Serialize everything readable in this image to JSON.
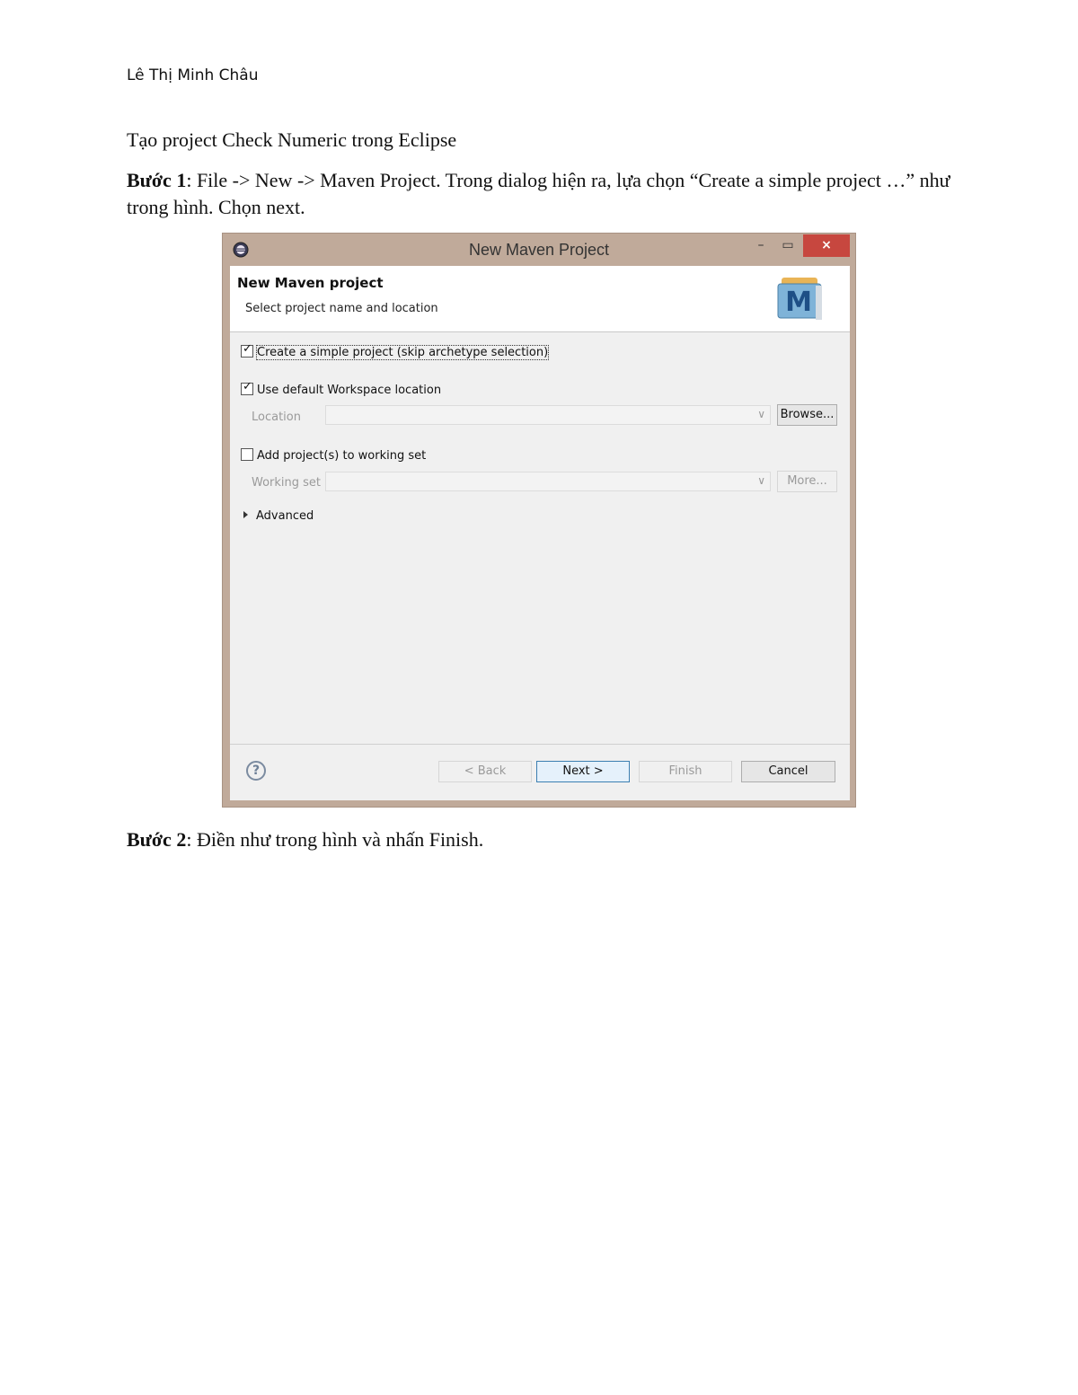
{
  "doc": {
    "author": "Lê Thị Minh Châu",
    "heading": "Tạo project Check Numeric trong Eclipse",
    "step1_label": "Bước 1",
    "step1_text": ": File -> New -> Maven Project. Trong dialog hiện ra, lựa chọn “Create a simple project …” như trong hình. Chọn next.",
    "step2_label": "Bước 2",
    "step2_text": ": Điền như trong hình và nhấn Finish."
  },
  "dialog": {
    "window_title": "New Maven Project",
    "close_glyph": "×",
    "banner_title": "New Maven project",
    "banner_subtitle": "Select project name and location",
    "logo_letter": "M",
    "simple_project_label": "Create a simple project (skip archetype selection)",
    "simple_project_checked": true,
    "default_workspace_label": "Use default Workspace location",
    "default_workspace_checked": true,
    "location_label": "Location",
    "location_value": "",
    "browse_label": "Browse...",
    "working_set_check_label": "Add project(s) to working set",
    "working_set_checked": false,
    "working_set_label": "Working set",
    "working_set_value": "",
    "more_label": "More...",
    "advanced_label": "Advanced",
    "help_glyph": "?",
    "back_label": "< Back",
    "next_label": "Next >",
    "finish_label": "Finish",
    "cancel_label": "Cancel"
  }
}
